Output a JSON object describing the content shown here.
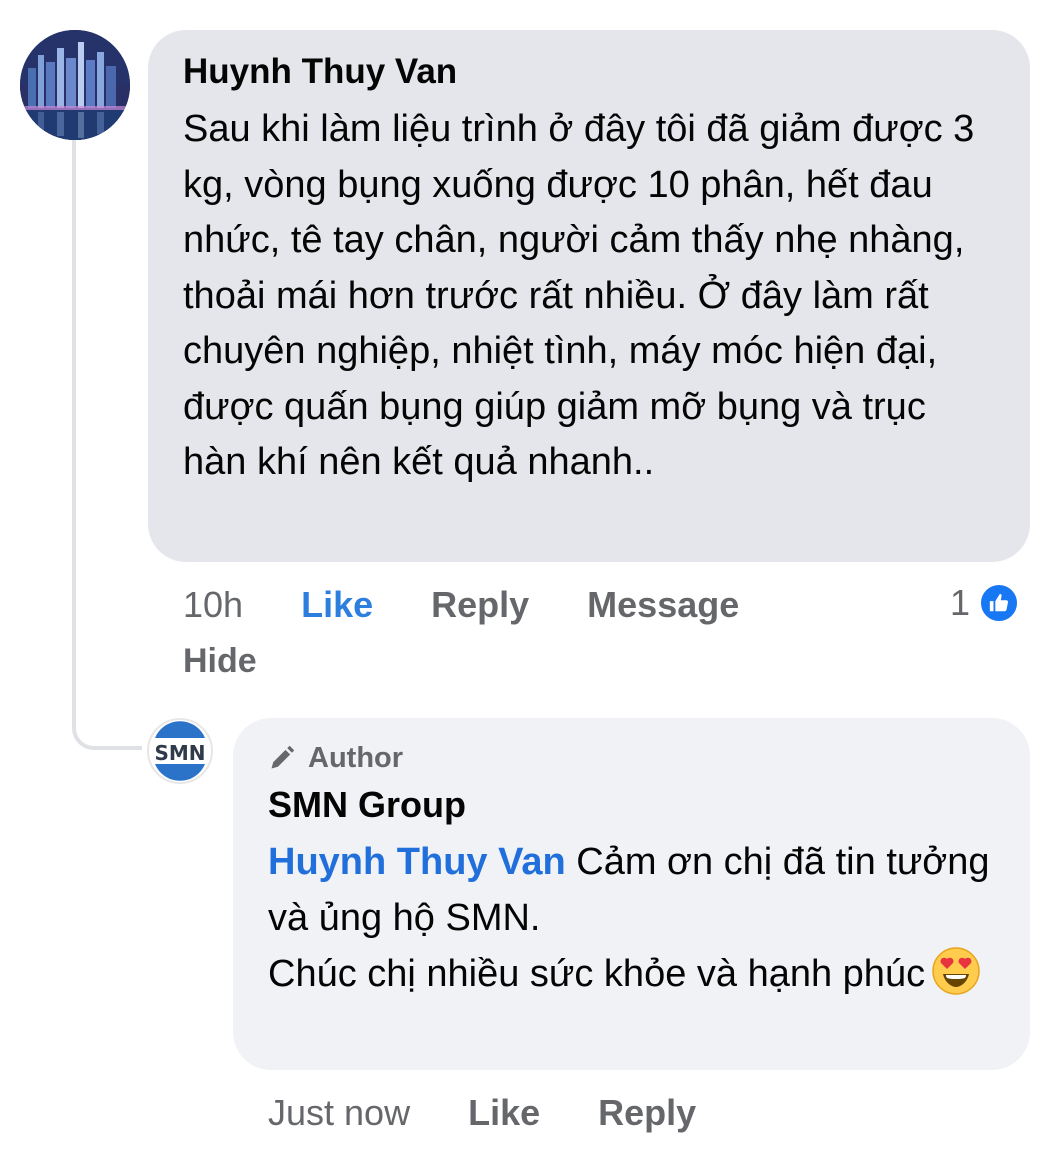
{
  "comment": {
    "author": "Huynh Thuy Van",
    "text": "Sau khi làm liệu trình ở đây tôi đã giảm được 3 kg, vòng bụng xuống được 10 phân, hết đau nhức, tê tay chân, người cảm thấy nhẹ nhàng, thoải mái hơn trước rất nhiều. Ở đây làm rất chuyên nghiệp, nhiệt tình, máy móc hiện đại, được quấn bụng giúp giảm mỡ bụng và trục hàn khí nên kết quả nhanh..",
    "time": "10h",
    "like_label": "Like",
    "reply_label": "Reply",
    "message_label": "Message",
    "hide_label": "Hide",
    "reaction_count": "1",
    "avatar_icon": "city-skyline-avatar",
    "reaction_icon": "thumbs-up-icon"
  },
  "reply": {
    "badge_label": "Author",
    "badge_icon": "pencil-icon",
    "author": "SMN Group",
    "mention": "Huynh Thuy Van",
    "text_line1": "Cảm ơn chị đã tin tưởng và ủng hộ SMN.",
    "text_line2": "Chúc chị nhiều sức khỏe và hạnh phúc",
    "emoji": "heart-eyes-emoji",
    "logo_text": "SMN",
    "time": "Just now",
    "like_label": "Like",
    "reply_label": "Reply"
  },
  "colors": {
    "bubble_main": "#e4e6eb",
    "bubble_reply": "#f0f2f5",
    "link_blue": "#216fdb",
    "meta_gray": "#65676b",
    "like_badge": "#1877f2"
  }
}
